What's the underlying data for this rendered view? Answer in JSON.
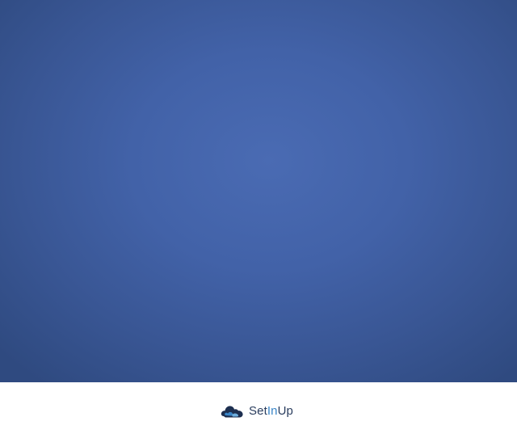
{
  "brand": {
    "name_part1": "Set",
    "name_part2": "In",
    "name_part3": "Up",
    "logo_icon": "cloud-logo-icon"
  },
  "colors": {
    "background_center": "#4a6bb3",
    "background_edge": "#2f4a80",
    "footer": "#ffffff",
    "brand_text": "#2a3d5e",
    "brand_accent": "#3a86c8"
  }
}
